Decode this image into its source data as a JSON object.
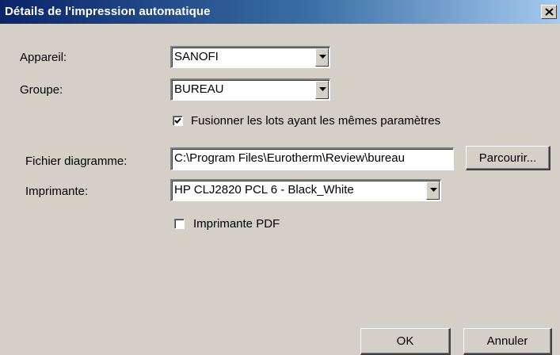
{
  "window": {
    "title": "Détails de l'impression automatique",
    "close_glyph": "x-close-icon"
  },
  "form": {
    "appareil": {
      "label": "Appareil:",
      "value": "SANOFI"
    },
    "groupe": {
      "label": "Groupe:",
      "value": "BUREAU"
    },
    "fusionner": {
      "label": "Fusionner les lots ayant les mêmes paramètres",
      "checked": true
    },
    "fichier": {
      "label": "Fichier diagramme:",
      "value": "C:\\Program Files\\Eurotherm\\Review\\bureau",
      "browse_label": "Parcourir..."
    },
    "imprimante": {
      "label": "Imprimante:",
      "value": "HP CLJ2820 PCL 6 - Black_White"
    },
    "imprimante_pdf": {
      "label": "Imprimante PDF",
      "checked": false
    }
  },
  "buttons": {
    "ok_label": "OK",
    "cancel_label": "Annuler"
  },
  "colors": {
    "face": "#d4d0c8",
    "title_start": "#0a246a",
    "title_end": "#a6caf0"
  }
}
